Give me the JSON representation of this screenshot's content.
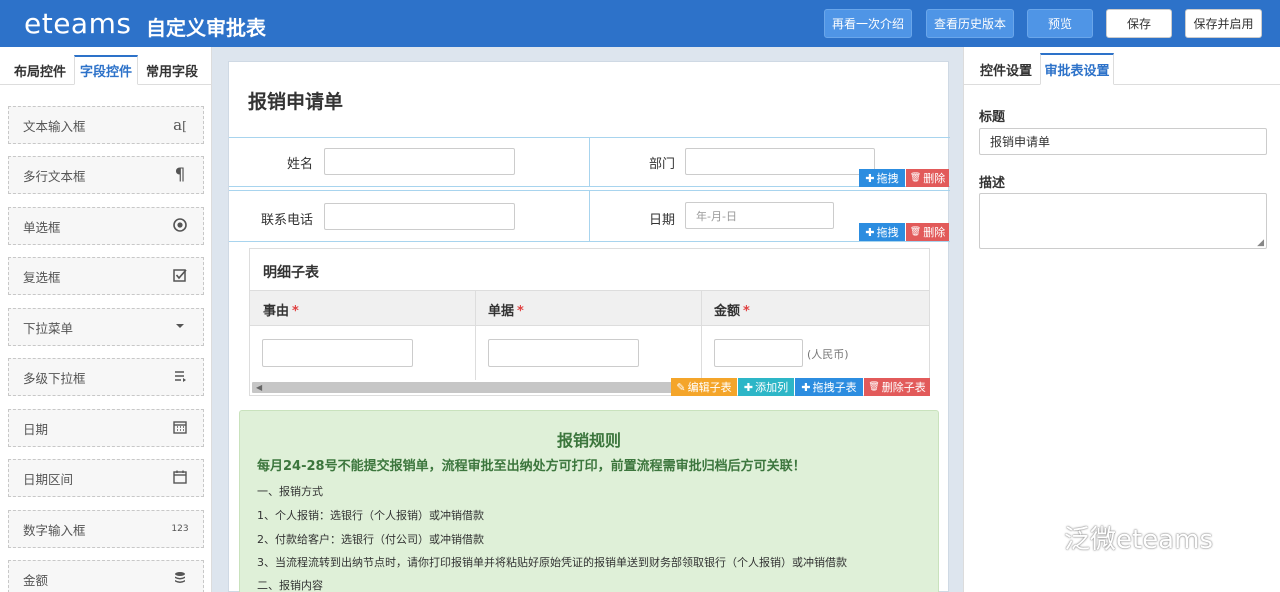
{
  "header": {
    "logo": "eteams",
    "title": "自定义审批表",
    "buttons": {
      "intro": "再看一次介绍",
      "history": "查看历史版本",
      "preview": "预览",
      "save": "保存",
      "save_enable": "保存并启用"
    }
  },
  "left": {
    "tabs": [
      "布局控件",
      "字段控件",
      "常用字段"
    ],
    "active_tab": "字段控件",
    "controls": [
      {
        "label": "文本输入框",
        "icon": "text-input-icon"
      },
      {
        "label": "多行文本框",
        "icon": "paragraph-icon"
      },
      {
        "label": "单选框",
        "icon": "radio-icon"
      },
      {
        "label": "复选框",
        "icon": "checkbox-icon"
      },
      {
        "label": "下拉菜单",
        "icon": "caret-down-icon"
      },
      {
        "label": "多级下拉框",
        "icon": "cascade-icon"
      },
      {
        "label": "日期",
        "icon": "calendar-icon"
      },
      {
        "label": "日期区间",
        "icon": "calendar-range-icon"
      },
      {
        "label": "数字输入框",
        "icon": "number-icon",
        "glyph": "123"
      },
      {
        "label": "金额",
        "icon": "coins-icon"
      }
    ]
  },
  "form": {
    "title": "报销申请单",
    "row1": {
      "name_label": "姓名",
      "dept_label": "部门"
    },
    "row2": {
      "phone_label": "联系电话",
      "date_label": "日期",
      "date_placeholder": "年-月-日"
    },
    "actions": {
      "drag": "拖拽",
      "delete": "删除"
    },
    "subtable": {
      "title": "明细子表",
      "columns": [
        "事由",
        "单据",
        "金额"
      ],
      "required_mark": "*",
      "currency_suffix": "(人民币)",
      "actions": {
        "edit": "编辑子表",
        "add_col": "添加列",
        "drag": "拖拽子表",
        "delete": "删除子表"
      }
    },
    "rules": {
      "title": "报销规则",
      "warning": "每月24-28号不能提交报销单，流程审批至出纳处方可打印，前置流程需审批归档后方可关联！",
      "lines": [
        "一、报销方式",
        "1、个人报销：选银行（个人报销）或冲销借款",
        "2、付款给客户：选银行（付公司）或冲销借款",
        "3、当流程流转到出纳节点时，请你打印报销单并将粘贴好原始凭证的报销单送到财务部领取银行（个人报销）或冲销借款",
        "二、报销内容"
      ]
    }
  },
  "right": {
    "tabs": [
      "控件设置",
      "审批表设置"
    ],
    "active_tab": "审批表设置",
    "title_label": "标题",
    "title_value": "报销申请单",
    "desc_label": "描述",
    "desc_value": ""
  },
  "watermark": "泛微eteams"
}
